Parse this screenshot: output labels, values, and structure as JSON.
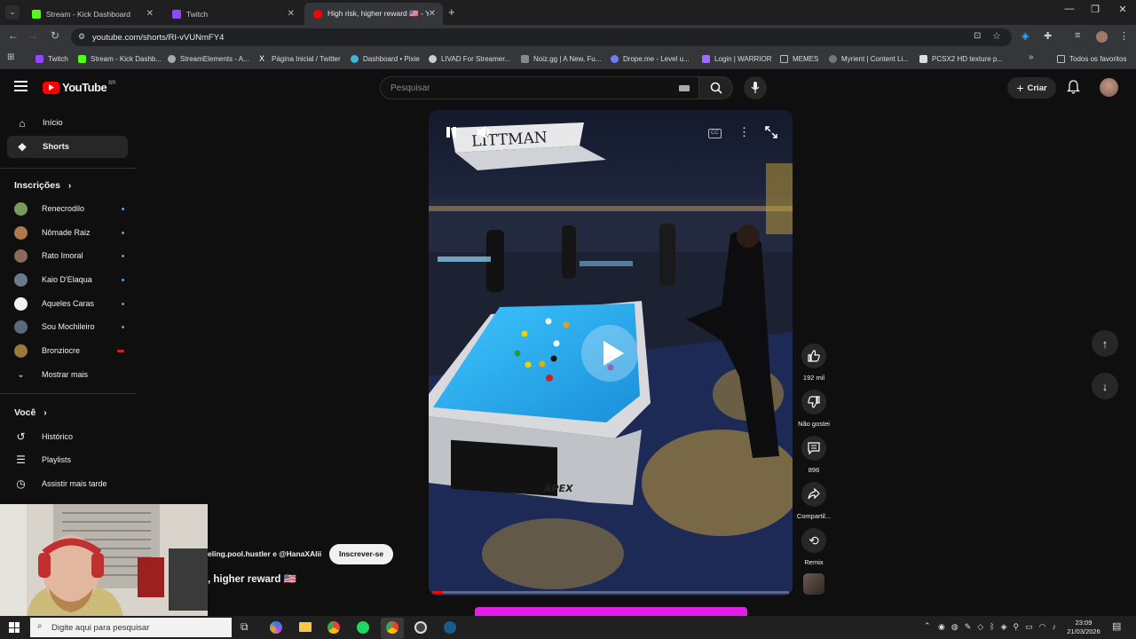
{
  "browser": {
    "tabs": [
      {
        "label": "Stream - Kick Dashboard",
        "color": "#53fc18",
        "active": false
      },
      {
        "label": "Twitch",
        "color": "#9146ff",
        "active": false
      },
      {
        "label": "High risk, higher reward 🇺🇸 - Y",
        "color": "#ff0000",
        "active": true
      }
    ],
    "new_tab": "+",
    "url": "youtube.com/shorts/RI-vVUNmFY4",
    "bookmarks": [
      {
        "label": "Twitch",
        "color": "#9146ff"
      },
      {
        "label": "Stream - Kick Dashb...",
        "color": "#53fc18"
      },
      {
        "label": "StreamElements - A...",
        "color": "#aaaaaa"
      },
      {
        "label": "Página Inicial / Twitter",
        "color": "#ffffff"
      },
      {
        "label": "Dashboard • Pixie",
        "color": "#3fb6d8"
      },
      {
        "label": "LIVAD For Streamer...",
        "color": "#cccccc"
      },
      {
        "label": "Noiz.gg | A New, Fu...",
        "color": "#888888"
      },
      {
        "label": "Drope.me - Level u...",
        "color": "#6a7cff"
      },
      {
        "label": "Login | WARRIOR",
        "color": "#a26bff"
      },
      {
        "label": "MEMES",
        "color": "#bbbbbb"
      },
      {
        "label": "Myrient | Content Li...",
        "color": "#777777"
      },
      {
        "label": "PCSX2 HD texture p...",
        "color": "#dddddd"
      }
    ],
    "all_bookmarks": "Todos os favoritos"
  },
  "youtube": {
    "logo_text": "YouTube",
    "region": "BR",
    "search_placeholder": "Pesquisar",
    "create_label": "Criar",
    "sidebar": {
      "main": [
        {
          "label": "Início",
          "icon": "home-icon",
          "selected": false
        },
        {
          "label": "Shorts",
          "icon": "shorts-icon",
          "selected": true
        }
      ],
      "subscriptions_title": "Inscrições",
      "subscriptions": [
        {
          "label": "Renecrodilo",
          "color": "#7a9a5a"
        },
        {
          "label": "Nômade Raiz",
          "color": "#b07a4a"
        },
        {
          "label": "Rato Imoral",
          "color": "#8a6a5a"
        },
        {
          "label": "Kaio D'Elaqua",
          "color": "#6a7a8a"
        },
        {
          "label": "Aqueles Caras",
          "color": "#f1f1f1"
        },
        {
          "label": "Sou Mochileiro",
          "color": "#5a6a7a"
        },
        {
          "label": "Bronziocre",
          "color": "#9a7a3a"
        }
      ],
      "show_more": "Mostrar mais",
      "you_title": "Você",
      "you_items": [
        {
          "label": "Histórico",
          "icon": "history-icon"
        },
        {
          "label": "Playlists",
          "icon": "playlists-icon"
        },
        {
          "label": "Assistir mais tarde",
          "icon": "watch-later-icon"
        }
      ]
    },
    "short": {
      "channel_text": "eling.pool.hustler e @HanaXAlii",
      "subscribe_label": "Inscrever-se",
      "title_text": ", higher reward 🇺🇸",
      "actions": [
        {
          "label": "192 mil",
          "icon": "like-icon"
        },
        {
          "label": "Não gostei",
          "icon": "dislike-icon"
        },
        {
          "label": "896",
          "icon": "comment-icon"
        },
        {
          "label": "Compartil...",
          "icon": "share-icon"
        },
        {
          "label": "Remix",
          "icon": "remix-icon"
        }
      ],
      "video_sign": "LITTMAN",
      "table_brand": "APEX",
      "progress": 0.03
    }
  },
  "taskbar": {
    "search_placeholder": "Digite aqui para pesquisar",
    "time": "23:09",
    "date": "21/03/2026"
  }
}
